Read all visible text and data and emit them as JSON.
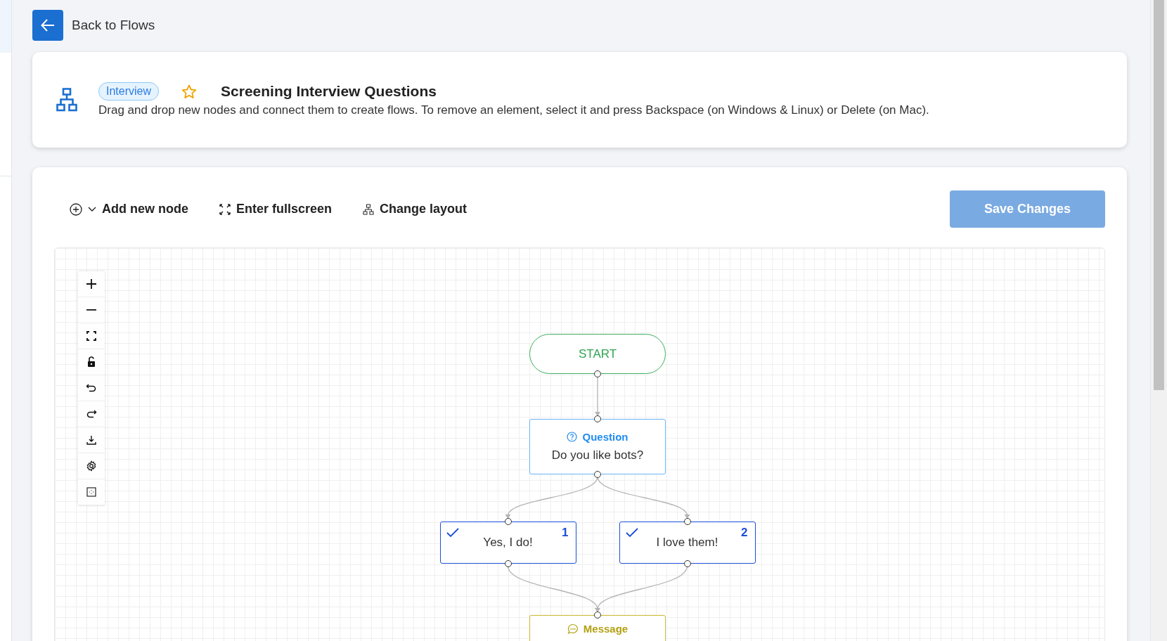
{
  "back_button": {
    "label": "Back to Flows"
  },
  "header": {
    "badge": "Interview",
    "title": "Screening Interview Questions",
    "description": "Drag and drop new nodes and connect them to create flows. To remove an element, select it and press Backspace (on Windows & Linux) or Delete (on Mac)."
  },
  "toolbar": {
    "items": [
      {
        "kind": "add",
        "label": "Add new node"
      },
      {
        "kind": "fullscreen",
        "label": "Enter fullscreen"
      },
      {
        "kind": "layout",
        "label": "Change layout"
      }
    ],
    "save_button": {
      "label": "Save Changes",
      "disabled": true
    }
  },
  "nodes": [
    {
      "kind": "start",
      "text": "START"
    },
    {
      "kind": "question",
      "title": "Question",
      "text": "Do you like bots?"
    },
    {
      "kind": "answer",
      "text": "Yes, I do!",
      "number": "1"
    },
    {
      "kind": "answer",
      "text": "I love them!",
      "number": "2"
    },
    {
      "kind": "message",
      "title": "Message"
    }
  ]
}
